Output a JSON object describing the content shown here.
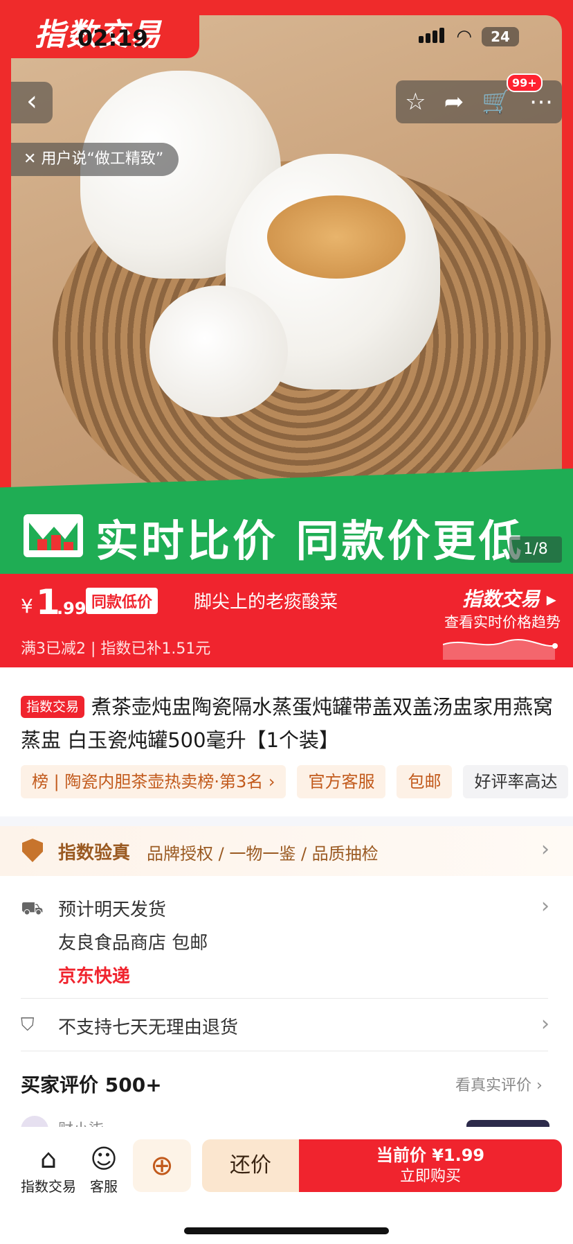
{
  "status_bar": {
    "time": "02:19",
    "battery": "24"
  },
  "hero": {
    "brand_tag": "指数交易",
    "user_says": "用户说“做工精致”",
    "banner_text": "实时比价 同款价更低",
    "pager": "1/8",
    "cart_badge": "99+"
  },
  "price": {
    "symbol": "¥",
    "integer": "1",
    "decimal": ".99",
    "low_badge": "同款低价",
    "shop_name": "脚尖上的老痰酸菜",
    "brand": "指数交易",
    "brand_sub": "查看实时价格趋势",
    "promo": "满3已减2 | 指数已补1.51元"
  },
  "product": {
    "tag": "指数交易",
    "title": "煮茶壶炖盅陶瓷隔水蒸蛋炖罐带盖双盖汤盅家用燕窝蒸盅 白玉瓷炖罐500毫升【1个装】",
    "chips": [
      {
        "label": "榜 | 陶瓷内胆茶壶热卖榜·第3名 ›"
      },
      {
        "label": "官方客服"
      },
      {
        "label": "包邮"
      },
      {
        "label": "好评率高达"
      }
    ]
  },
  "verify": {
    "title": "指数验真",
    "items": "品牌授权 / 一物一鉴 / 品质抽检"
  },
  "shipping": {
    "line1": "预计明天发货",
    "line2": "友良食品商店  包邮",
    "carrier": "京东快递",
    "return_policy": "不支持七天无理由退货"
  },
  "reviews": {
    "title": "买家评价 500+",
    "link": "看真实评价 ›",
    "reviewer": "财小柒"
  },
  "bottom_bar": {
    "tab1": "指数交易",
    "tab2": "客服",
    "bargain": "还价",
    "buy_price": "当前价 ¥1.99",
    "buy_label": "立即购买"
  },
  "colors": {
    "accent": "#f0242e",
    "banner_green": "#1fad54",
    "gold": "#c7742c"
  },
  "icons": [
    "back-icon",
    "star-icon",
    "share-icon",
    "cart-icon",
    "more-icon",
    "close-icon",
    "shield-icon",
    "truck-icon",
    "return-shield-icon",
    "store-icon",
    "service-icon",
    "add-cart-icon"
  ]
}
